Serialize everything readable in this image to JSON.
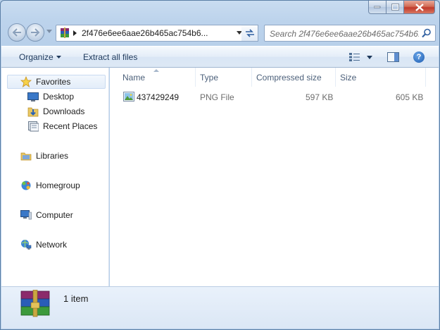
{
  "window": {
    "address_path": "2f476e6ee6aae26b465ac754b6...",
    "search_placeholder": "Search 2f476e6ee6aae26b465ac754b6...",
    "accent": "#1e395b"
  },
  "toolbar": {
    "organize_label": "Organize",
    "extract_label": "Extract all files"
  },
  "nav": {
    "favorites": "Favorites",
    "desktop": "Desktop",
    "downloads": "Downloads",
    "recent_places": "Recent Places",
    "libraries": "Libraries",
    "homegroup": "Homegroup",
    "computer": "Computer",
    "network": "Network"
  },
  "columns": {
    "name": "Name",
    "type": "Type",
    "compressed": "Compressed size",
    "size": "Size"
  },
  "files": [
    {
      "name": "437429249",
      "type": "PNG File",
      "compressed_size": "597 KB",
      "size": "605 KB",
      "icon": "png-file-icon"
    }
  ],
  "status": {
    "item_count": "1 item"
  }
}
